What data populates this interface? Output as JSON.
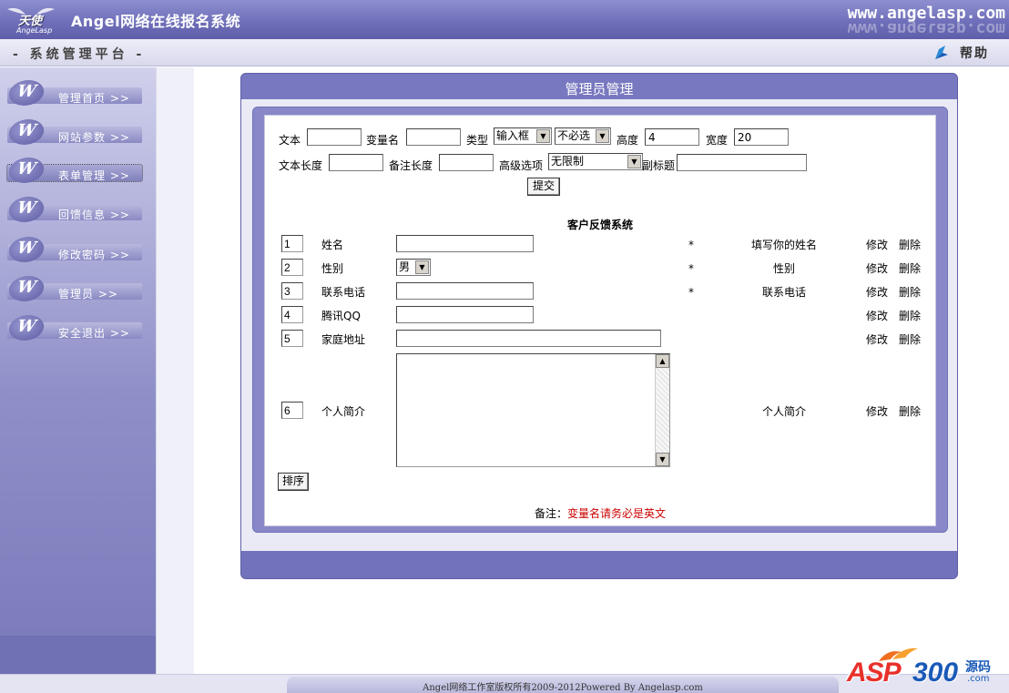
{
  "header": {
    "logo_text": "天使",
    "logo_sub": "AngeLasp",
    "app_title": "Angel网络在线报名系统",
    "site_url": "www.angelasp.com"
  },
  "subbar": {
    "platform": "- 系统管理平台 -",
    "help": "帮助"
  },
  "sidebar": {
    "items": [
      {
        "label": "管理首页 >>"
      },
      {
        "label": "网站参数 >>"
      },
      {
        "label": "表单管理 >>"
      },
      {
        "label": "回馈信息 >>"
      },
      {
        "label": "修改密码 >>"
      },
      {
        "label": "管理员 >>"
      },
      {
        "label": "安全退出 >>"
      }
    ],
    "active_index": 2,
    "icon_letter": "W"
  },
  "panel": {
    "title": "管理员管理"
  },
  "config": {
    "text_label": "文本",
    "text_value": "",
    "varname_label": "变量名",
    "varname_value": "",
    "type_label": "类型",
    "type_selected": "输入框",
    "required_selected": "不必选",
    "height_label": "高度",
    "height_value": "4",
    "width_label": "宽度",
    "width_value": "20",
    "textlen_label": "文本长度",
    "textlen_value": "",
    "notelen_label": "备注长度",
    "notelen_value": "",
    "advanced_label": "高级选项",
    "advanced_selected": "无限制",
    "subtitle_label": "副标题",
    "subtitle_value": "",
    "submit_label": "提交"
  },
  "form_preview": {
    "title": "客户反馈系统",
    "rows": [
      {
        "order": "1",
        "label": "姓名",
        "required": "*",
        "hint": "填写你的姓名",
        "edit": "修改",
        "delete": "删除"
      },
      {
        "order": "2",
        "label": "性别",
        "select_value": "男",
        "required": "*",
        "hint": "性别",
        "edit": "修改",
        "delete": "删除"
      },
      {
        "order": "3",
        "label": "联系电话",
        "required": "*",
        "hint": "联系电话",
        "edit": "修改",
        "delete": "删除"
      },
      {
        "order": "4",
        "label": "腾讯QQ",
        "required": "",
        "hint": "",
        "edit": "修改",
        "delete": "删除"
      },
      {
        "order": "5",
        "label": "家庭地址",
        "required": "",
        "hint": "",
        "edit": "修改",
        "delete": "删除"
      },
      {
        "order": "6",
        "label": "个人简介",
        "required": "",
        "hint": "个人简介",
        "edit": "修改",
        "delete": "删除"
      }
    ],
    "sort_label": "排序",
    "note_label": "备注：",
    "note_text": "变量名请务必是英文"
  },
  "footer": {
    "copyright": "Angel网络工作室版权所有2009-2012Powered By Angelasp.com"
  },
  "watermark": {
    "asp": "ASP",
    "num": "300",
    "cn": "源码",
    "com": ".com"
  },
  "colors": {
    "header": "#6d6db8",
    "note_red": "#cc0000",
    "watermark_red": "#e8302a",
    "watermark_blue": "#1a5ab8"
  }
}
